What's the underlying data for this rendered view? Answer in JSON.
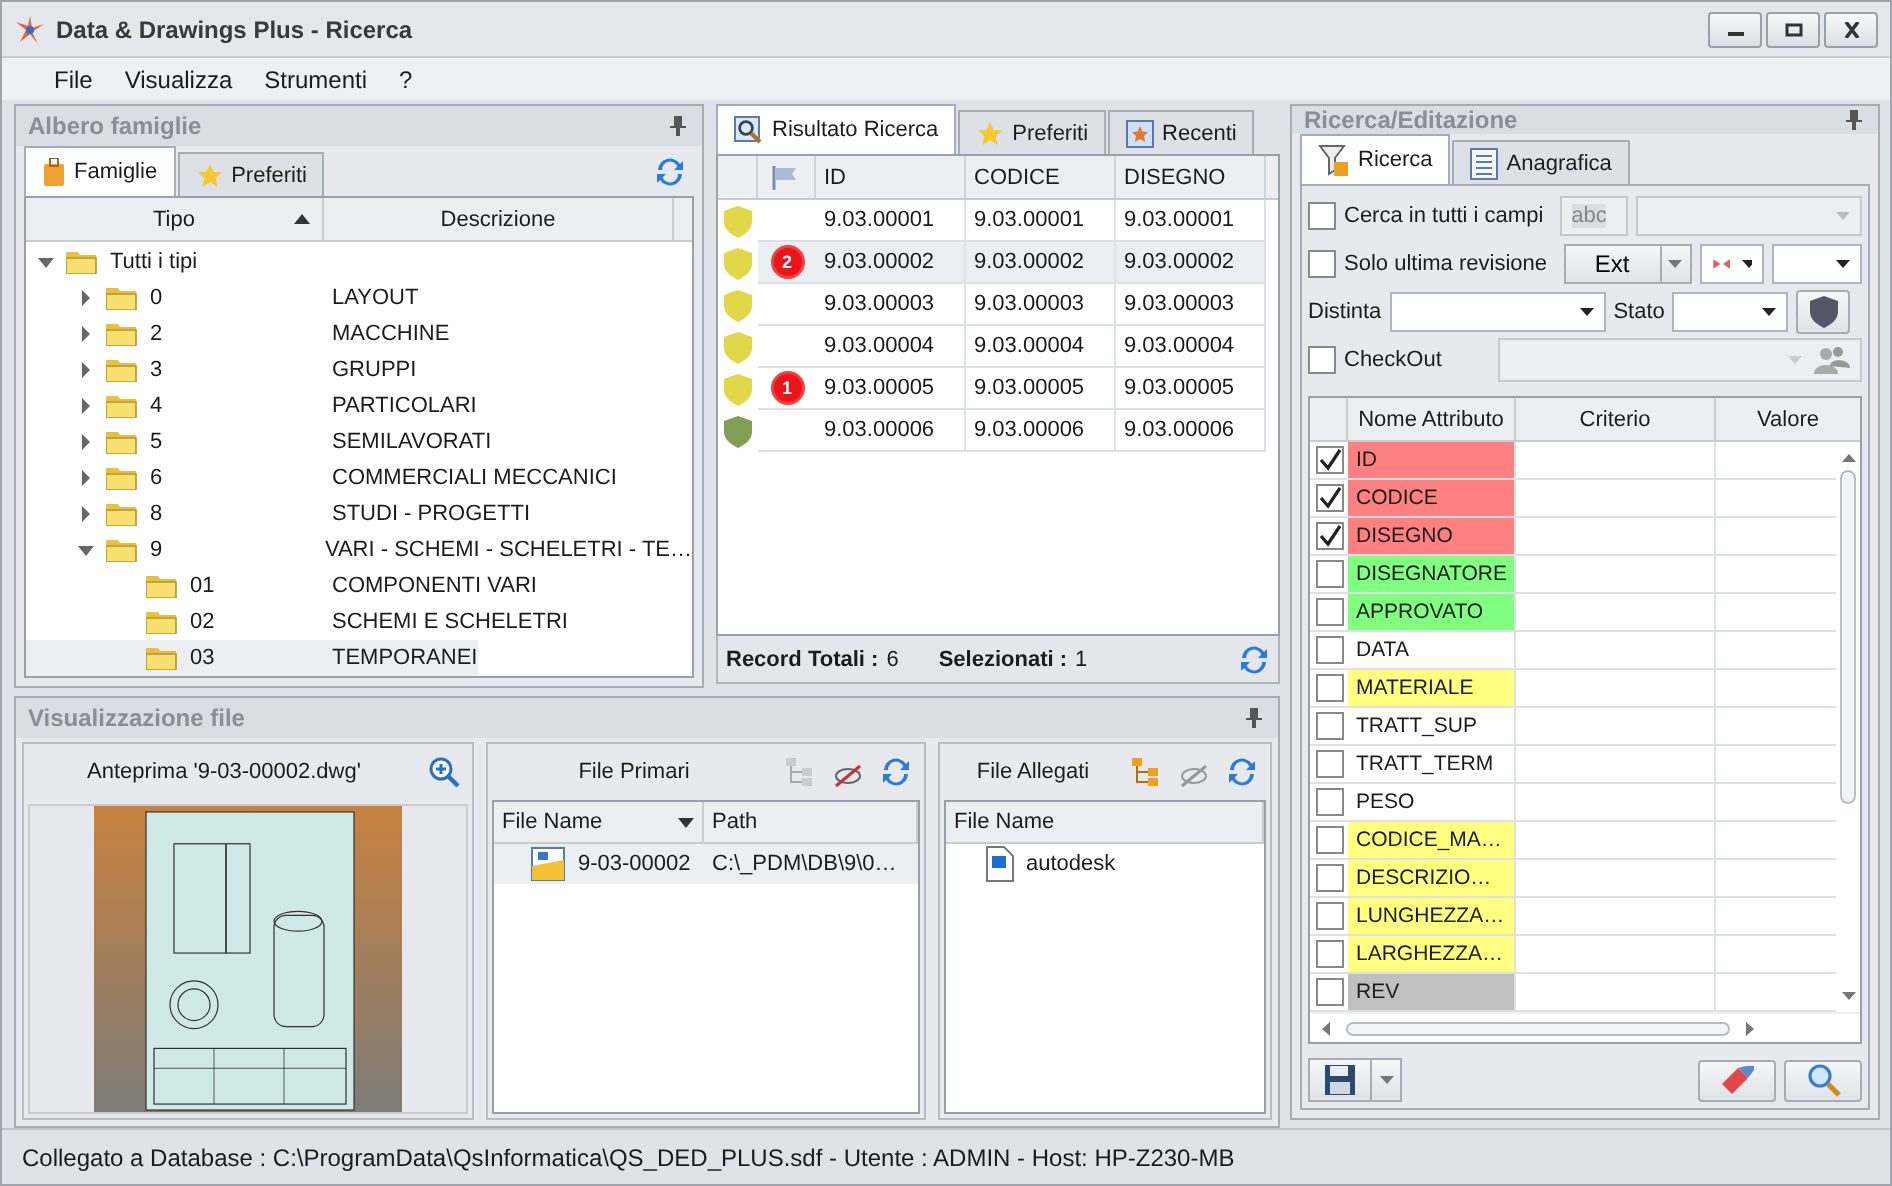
{
  "window": {
    "title": "Data & Drawings Plus - Ricerca"
  },
  "menu": [
    "File",
    "Visualizza",
    "Strumenti",
    "?"
  ],
  "family_tree": {
    "title": "Albero famiglie",
    "tabs": [
      {
        "label": "Famiglie",
        "selected": true
      },
      {
        "label": "Preferiti",
        "selected": false
      }
    ],
    "columns": [
      {
        "label": "Tipo",
        "sorted": true
      },
      {
        "label": "Descrizione",
        "sorted": false
      }
    ],
    "nodes": [
      {
        "tipo": "Tutti i tipi",
        "expanded": true,
        "selected": false,
        "children": [
          {
            "tipo": "0",
            "descrizione": "LAYOUT",
            "expanded": false,
            "selected": false
          },
          {
            "tipo": "2",
            "descrizione": "MACCHINE",
            "expanded": false,
            "selected": false
          },
          {
            "tipo": "3",
            "descrizione": "GRUPPI",
            "expanded": false,
            "selected": false
          },
          {
            "tipo": "4",
            "descrizione": "PARTICOLARI",
            "expanded": false,
            "selected": false
          },
          {
            "tipo": "5",
            "descrizione": "SEMILAVORATI",
            "expanded": false,
            "selected": false
          },
          {
            "tipo": "6",
            "descrizione": "COMMERCIALI MECCANICI",
            "expanded": false,
            "selected": false
          },
          {
            "tipo": "8",
            "descrizione": "STUDI - PROGETTI",
            "expanded": false,
            "selected": false
          },
          {
            "tipo": "9",
            "descrizione": "VARI - SCHEMI - SCHELETRI - TE…",
            "expanded": true,
            "selected": false,
            "children": [
              {
                "tipo": "01",
                "descrizione": "COMPONENTI VARI",
                "selected": false
              },
              {
                "tipo": "02",
                "descrizione": "SCHEMI E SCHELETRI",
                "selected": false
              },
              {
                "tipo": "03",
                "descrizione": "TEMPORANEI",
                "selected": true
              }
            ]
          }
        ]
      }
    ]
  },
  "results": {
    "tabs": [
      {
        "label": "Risultato Ricerca",
        "selected": true
      },
      {
        "label": "Preferiti",
        "selected": false
      },
      {
        "label": "Recenti",
        "selected": false
      }
    ],
    "columns": [
      "ID",
      "CODICE",
      "DISEGNO"
    ],
    "rows": [
      {
        "color": "#e0d848",
        "id": "9.03.00001",
        "codice": "9.03.00001",
        "disegno": "9.03.00001",
        "selected": false
      },
      {
        "color": "#e0d848",
        "badge": "2",
        "id": "9.03.00002",
        "codice": "9.03.00002",
        "disegno": "9.03.00002",
        "selected": true
      },
      {
        "color": "#e0d848",
        "id": "9.03.00003",
        "codice": "9.03.00003",
        "disegno": "9.03.00003",
        "selected": false
      },
      {
        "color": "#e0d848",
        "id": "9.03.00004",
        "codice": "9.03.00004",
        "disegno": "9.03.00004",
        "selected": false
      },
      {
        "color": "#e0d848",
        "badge": "1",
        "id": "9.03.00005",
        "codice": "9.03.00005",
        "disegno": "9.03.00005",
        "selected": false
      },
      {
        "color": "#7fa055",
        "id": "9.03.00006",
        "codice": "9.03.00006",
        "disegno": "9.03.00006",
        "selected": false
      }
    ],
    "total_label": "Record Totali :",
    "total": "6",
    "selected_label": "Selezionati :",
    "selected_count": "1"
  },
  "search": {
    "title": "Ricerca/Editazione",
    "tabs": [
      {
        "label": "Ricerca",
        "selected": true
      },
      {
        "label": "Anagrafica",
        "selected": false
      }
    ],
    "search_all": {
      "label": "Cerca in tutti i campi",
      "checked": false,
      "type_hint": "abc"
    },
    "last_revision": {
      "label": "Solo ultima revisione",
      "checked": false,
      "ext_button": "Ext"
    },
    "distinta_label": "Distinta",
    "stato_label": "Stato",
    "checkout": {
      "label": "CheckOut",
      "checked": false
    },
    "columns": [
      "Nome Attributo",
      "Criterio",
      "Valore"
    ],
    "attributes": [
      {
        "name": "ID",
        "checked": true,
        "color": "#ff8080"
      },
      {
        "name": "CODICE",
        "checked": true,
        "color": "#ff8080"
      },
      {
        "name": "DISEGNO",
        "checked": true,
        "color": "#ff8080"
      },
      {
        "name": "DISEGNATORE",
        "checked": false,
        "color": "#80ff80"
      },
      {
        "name": "APPROVATO",
        "checked": false,
        "color": "#80ff80"
      },
      {
        "name": "DATA",
        "checked": false,
        "color": "#ffffff"
      },
      {
        "name": "MATERIALE",
        "checked": false,
        "color": "#ffff80"
      },
      {
        "name": "TRATT_SUP",
        "checked": false,
        "color": "#ffffff"
      },
      {
        "name": "TRATT_TERM",
        "checked": false,
        "color": "#ffffff"
      },
      {
        "name": "PESO",
        "checked": false,
        "color": "#ffffff"
      },
      {
        "name": "CODICE_MA…",
        "checked": false,
        "color": "#ffff80"
      },
      {
        "name": "DESCRIZIO…",
        "checked": false,
        "color": "#ffff80"
      },
      {
        "name": "LUNGHEZZA…",
        "checked": false,
        "color": "#ffff80"
      },
      {
        "name": "LARGHEZZA…",
        "checked": false,
        "color": "#ffff80"
      },
      {
        "name": "REV",
        "checked": false,
        "color": "#c0c0c0"
      }
    ]
  },
  "files": {
    "title": "Visualizzazione file",
    "preview": {
      "title": "Anteprima '9-03-00002.dwg'",
      "kind": "picture"
    },
    "primary": {
      "title": "File Primari",
      "columns": [
        "File Name",
        "Path"
      ],
      "rows": [
        {
          "file_name": "9-03-00002",
          "path": "C:\\_PDM\\DB\\9\\0…"
        }
      ]
    },
    "attached": {
      "title": "File Allegati",
      "columns": [
        "File Name"
      ],
      "rows": [
        {
          "file_name": "autodesk"
        }
      ]
    }
  },
  "status_bar": "Collegato a Database : C:\\ProgramData\\QsInformatica\\QS_DED_PLUS.sdf  -  Utente : ADMIN  -  Host: HP-Z230-MB"
}
